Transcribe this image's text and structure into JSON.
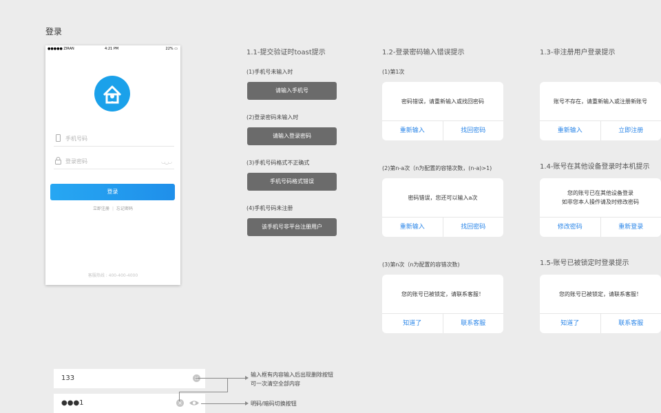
{
  "page_title": "登录",
  "phone": {
    "status_left": "●●●●● ZIRAN",
    "status_time": "4:21 PM",
    "status_battery": "22%",
    "phone_placeholder": "手机号码",
    "password_placeholder": "登录密码",
    "login_button": "登录",
    "register_link": "立即注册",
    "forgot_link": "忘记密码",
    "hotline": "客服热线 : 400-400-4000"
  },
  "toasts": {
    "title": "1.1-提交验证时toast提示",
    "items": [
      {
        "label": "(1)手机号未输入时",
        "text": "请输入手机号"
      },
      {
        "label": "(2)登录密码未输入时",
        "text": "请输入登录密码"
      },
      {
        "label": "(3)手机号码格式不正确式",
        "text": "手机号码格式错误"
      },
      {
        "label": "(4)手机号码未注册",
        "text": "该手机号非平台注册用户"
      }
    ]
  },
  "password_errors": {
    "title": "1.2-登录密码输入错误提示",
    "items": [
      {
        "label": "(1)第1次",
        "message": "密码错误，请重新输入或找回密码",
        "btn1": "重新输入",
        "btn2": "找回密码"
      },
      {
        "label": "(2)第n-a次（n为配置的容错次数，(n-a)>1)",
        "message": "密码错误，您还可以输入a次",
        "btn1": "重新输入",
        "btn2": "找回密码"
      },
      {
        "label": "(3)第n次（n为配置的容错次数)",
        "message": "您的账号已被锁定，请联系客服！",
        "btn1": "知道了",
        "btn2": "联系客服"
      }
    ]
  },
  "unregistered": {
    "title": "1.3-非注册用户登录提示",
    "message": "账号不存在，请重新输入或注册新账号",
    "btn1": "重新输入",
    "btn2": "立即注册"
  },
  "other_device": {
    "title": "1.4-账号在其他设备登录时本机提示",
    "message_line1": "您的账号已在其他设备登录",
    "message_line2": "如非您本人操作请及时修改密码",
    "btn1": "修改密码",
    "btn2": "重新登录"
  },
  "locked": {
    "title": "1.5-账号已被锁定时登录提示",
    "message": "您的账号已被锁定，请联系客服！",
    "btn1": "知道了",
    "btn2": "联系客服"
  },
  "inputs": {
    "phone_value": "133",
    "password_value": "●●●1",
    "clear_note_line1": "输入框有内容输入后出现删除按钮",
    "clear_note_line2": "可一次清空全部内容",
    "toggle_note": "明码/暗码切换按钮"
  },
  "colors": {
    "accent": "#2b86e8",
    "toast_bg": "#6b6b6b",
    "button_blue": "#1f8fea",
    "background": "#ececec"
  }
}
